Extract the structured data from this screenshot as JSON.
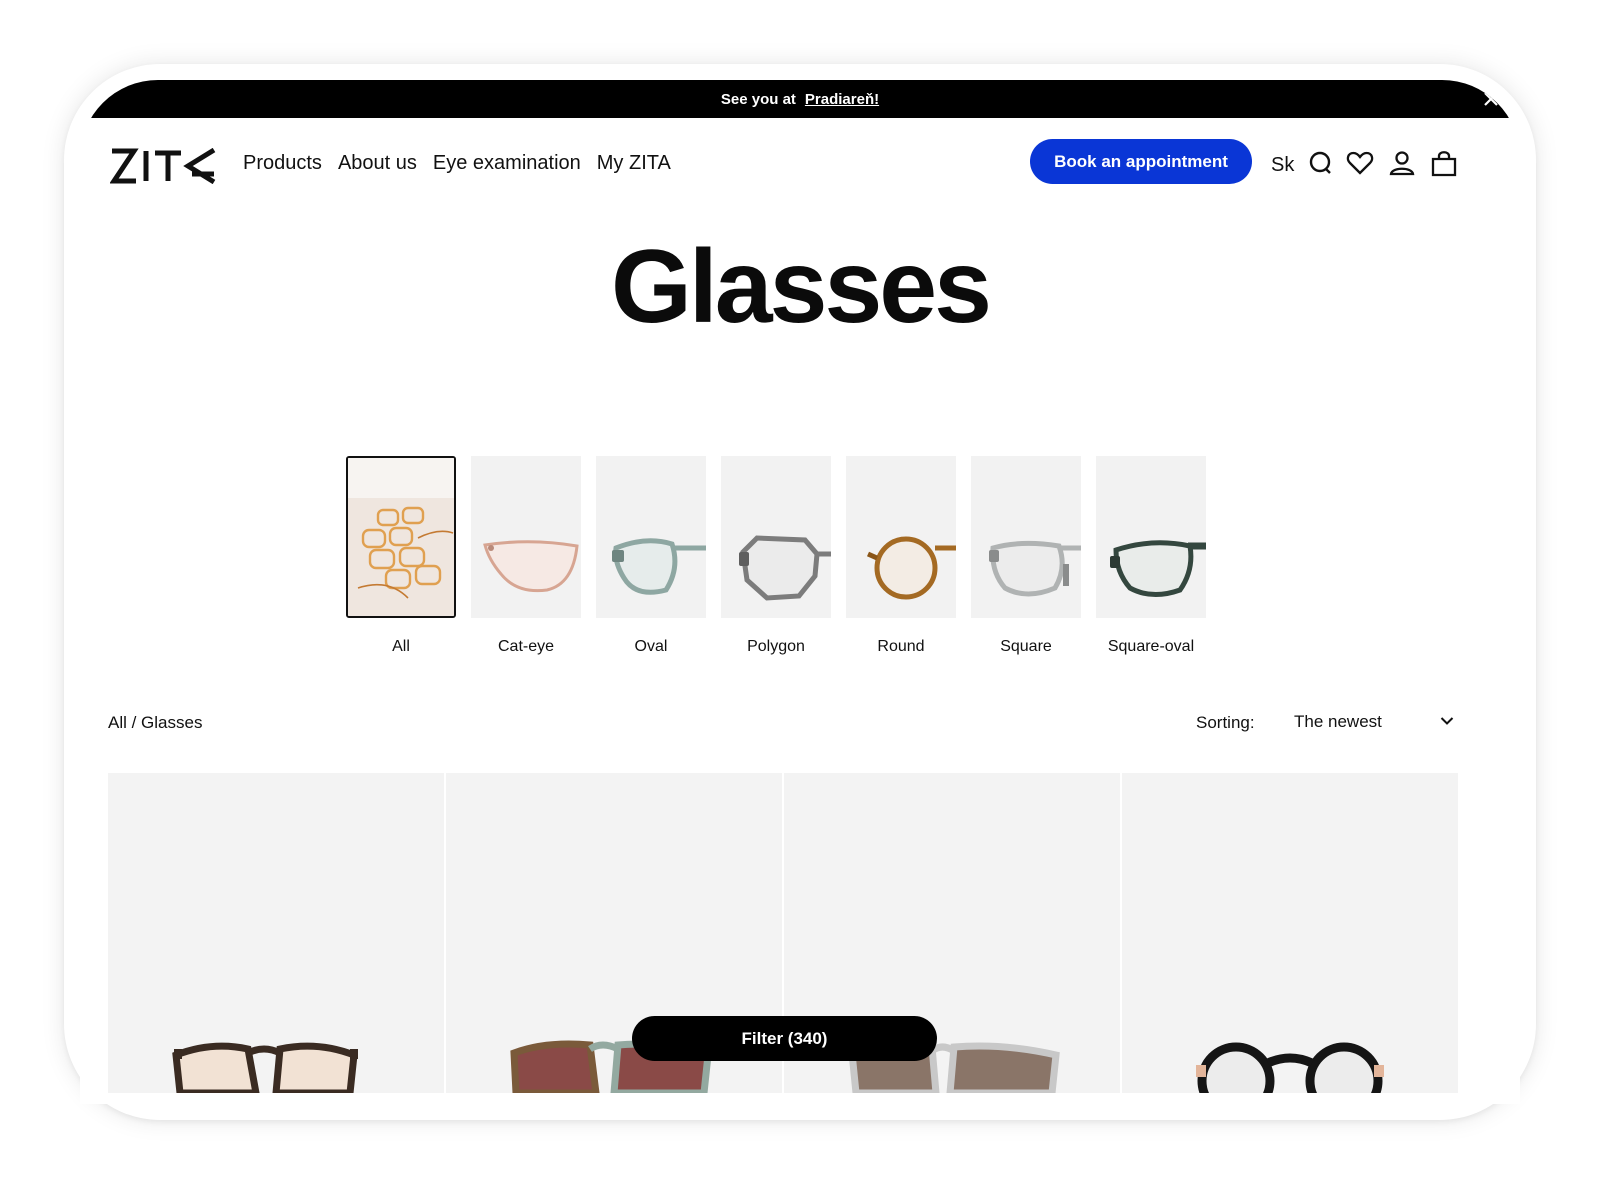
{
  "announcement": {
    "prefix": "See you at",
    "link": "Pradiareň!"
  },
  "header": {
    "nav": [
      "Products",
      "About us",
      "Eye examination",
      "My ZITA"
    ],
    "book_label": "Book an appointment",
    "lang": "Sk",
    "icons": [
      "search-icon",
      "heart-icon",
      "user-icon",
      "bag-icon"
    ]
  },
  "page": {
    "title": "Glasses"
  },
  "categories": [
    "All",
    "Cat-eye",
    "Oval",
    "Polygon",
    "Round",
    "Square",
    "Square-oval"
  ],
  "listing": {
    "breadcrumb": "All / Glasses",
    "sorting_label": "Sorting:",
    "sorting_value": "The newest",
    "filter_label": "Filter (340)"
  },
  "colors": {
    "accent": "#0a36d6",
    "bar": "#000000"
  }
}
